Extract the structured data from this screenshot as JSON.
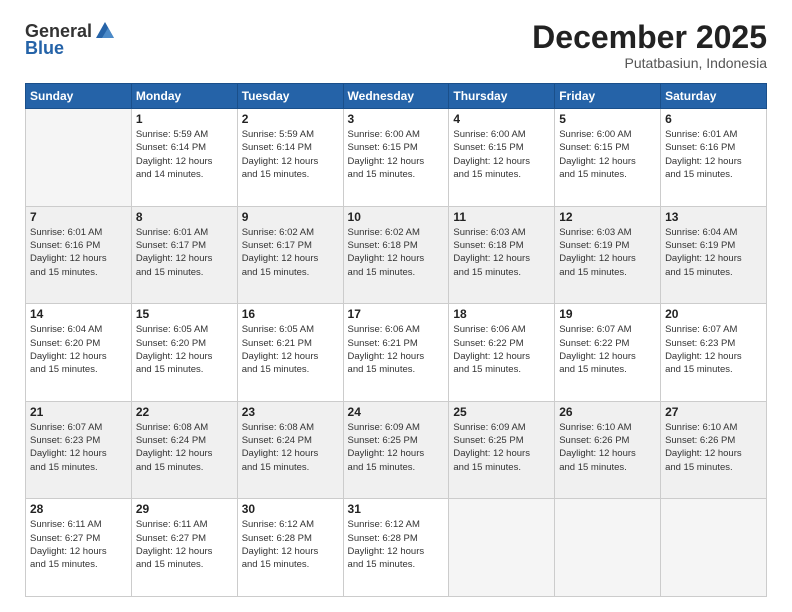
{
  "logo": {
    "general": "General",
    "blue": "Blue"
  },
  "header": {
    "month": "December 2025",
    "location": "Putatbasiun, Indonesia"
  },
  "weekdays": [
    "Sunday",
    "Monday",
    "Tuesday",
    "Wednesday",
    "Thursday",
    "Friday",
    "Saturday"
  ],
  "weeks": [
    [
      {
        "day": "",
        "info": ""
      },
      {
        "day": "1",
        "info": "Sunrise: 5:59 AM\nSunset: 6:14 PM\nDaylight: 12 hours\nand 14 minutes."
      },
      {
        "day": "2",
        "info": "Sunrise: 5:59 AM\nSunset: 6:14 PM\nDaylight: 12 hours\nand 15 minutes."
      },
      {
        "day": "3",
        "info": "Sunrise: 6:00 AM\nSunset: 6:15 PM\nDaylight: 12 hours\nand 15 minutes."
      },
      {
        "day": "4",
        "info": "Sunrise: 6:00 AM\nSunset: 6:15 PM\nDaylight: 12 hours\nand 15 minutes."
      },
      {
        "day": "5",
        "info": "Sunrise: 6:00 AM\nSunset: 6:15 PM\nDaylight: 12 hours\nand 15 minutes."
      },
      {
        "day": "6",
        "info": "Sunrise: 6:01 AM\nSunset: 6:16 PM\nDaylight: 12 hours\nand 15 minutes."
      }
    ],
    [
      {
        "day": "7",
        "info": "Sunrise: 6:01 AM\nSunset: 6:16 PM\nDaylight: 12 hours\nand 15 minutes."
      },
      {
        "day": "8",
        "info": "Sunrise: 6:01 AM\nSunset: 6:17 PM\nDaylight: 12 hours\nand 15 minutes."
      },
      {
        "day": "9",
        "info": "Sunrise: 6:02 AM\nSunset: 6:17 PM\nDaylight: 12 hours\nand 15 minutes."
      },
      {
        "day": "10",
        "info": "Sunrise: 6:02 AM\nSunset: 6:18 PM\nDaylight: 12 hours\nand 15 minutes."
      },
      {
        "day": "11",
        "info": "Sunrise: 6:03 AM\nSunset: 6:18 PM\nDaylight: 12 hours\nand 15 minutes."
      },
      {
        "day": "12",
        "info": "Sunrise: 6:03 AM\nSunset: 6:19 PM\nDaylight: 12 hours\nand 15 minutes."
      },
      {
        "day": "13",
        "info": "Sunrise: 6:04 AM\nSunset: 6:19 PM\nDaylight: 12 hours\nand 15 minutes."
      }
    ],
    [
      {
        "day": "14",
        "info": "Sunrise: 6:04 AM\nSunset: 6:20 PM\nDaylight: 12 hours\nand 15 minutes."
      },
      {
        "day": "15",
        "info": "Sunrise: 6:05 AM\nSunset: 6:20 PM\nDaylight: 12 hours\nand 15 minutes."
      },
      {
        "day": "16",
        "info": "Sunrise: 6:05 AM\nSunset: 6:21 PM\nDaylight: 12 hours\nand 15 minutes."
      },
      {
        "day": "17",
        "info": "Sunrise: 6:06 AM\nSunset: 6:21 PM\nDaylight: 12 hours\nand 15 minutes."
      },
      {
        "day": "18",
        "info": "Sunrise: 6:06 AM\nSunset: 6:22 PM\nDaylight: 12 hours\nand 15 minutes."
      },
      {
        "day": "19",
        "info": "Sunrise: 6:07 AM\nSunset: 6:22 PM\nDaylight: 12 hours\nand 15 minutes."
      },
      {
        "day": "20",
        "info": "Sunrise: 6:07 AM\nSunset: 6:23 PM\nDaylight: 12 hours\nand 15 minutes."
      }
    ],
    [
      {
        "day": "21",
        "info": "Sunrise: 6:07 AM\nSunset: 6:23 PM\nDaylight: 12 hours\nand 15 minutes."
      },
      {
        "day": "22",
        "info": "Sunrise: 6:08 AM\nSunset: 6:24 PM\nDaylight: 12 hours\nand 15 minutes."
      },
      {
        "day": "23",
        "info": "Sunrise: 6:08 AM\nSunset: 6:24 PM\nDaylight: 12 hours\nand 15 minutes."
      },
      {
        "day": "24",
        "info": "Sunrise: 6:09 AM\nSunset: 6:25 PM\nDaylight: 12 hours\nand 15 minutes."
      },
      {
        "day": "25",
        "info": "Sunrise: 6:09 AM\nSunset: 6:25 PM\nDaylight: 12 hours\nand 15 minutes."
      },
      {
        "day": "26",
        "info": "Sunrise: 6:10 AM\nSunset: 6:26 PM\nDaylight: 12 hours\nand 15 minutes."
      },
      {
        "day": "27",
        "info": "Sunrise: 6:10 AM\nSunset: 6:26 PM\nDaylight: 12 hours\nand 15 minutes."
      }
    ],
    [
      {
        "day": "28",
        "info": "Sunrise: 6:11 AM\nSunset: 6:27 PM\nDaylight: 12 hours\nand 15 minutes."
      },
      {
        "day": "29",
        "info": "Sunrise: 6:11 AM\nSunset: 6:27 PM\nDaylight: 12 hours\nand 15 minutes."
      },
      {
        "day": "30",
        "info": "Sunrise: 6:12 AM\nSunset: 6:28 PM\nDaylight: 12 hours\nand 15 minutes."
      },
      {
        "day": "31",
        "info": "Sunrise: 6:12 AM\nSunset: 6:28 PM\nDaylight: 12 hours\nand 15 minutes."
      },
      {
        "day": "",
        "info": ""
      },
      {
        "day": "",
        "info": ""
      },
      {
        "day": "",
        "info": ""
      }
    ]
  ]
}
